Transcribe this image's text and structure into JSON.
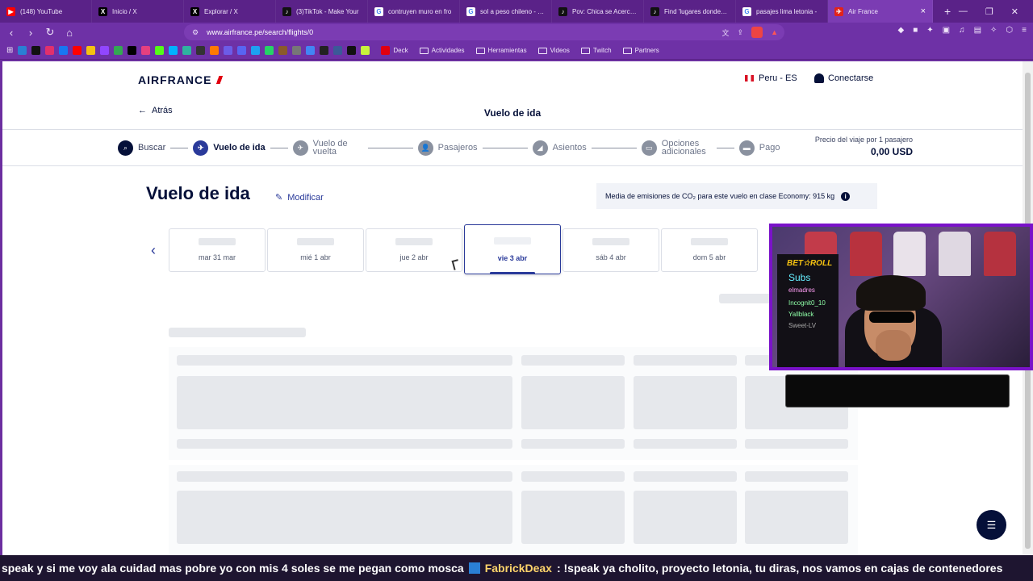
{
  "browser": {
    "tabs": [
      {
        "label": "(148) YouTube",
        "icon": "youtube-icon",
        "color": "#ff0000",
        "glyph": "▶"
      },
      {
        "label": "Inicio / X",
        "icon": "x-icon",
        "color": "#000000",
        "glyph": "X"
      },
      {
        "label": "Explorar / X",
        "icon": "x-icon",
        "color": "#000000",
        "glyph": "X"
      },
      {
        "label": "(3)TikTok - Make Your",
        "icon": "tiktok-icon",
        "color": "#111111",
        "glyph": "♪"
      },
      {
        "label": "contruyen muro en fro",
        "icon": "google-icon",
        "color": "#ffffff",
        "glyph": "G"
      },
      {
        "label": "sol a peso chileno - Go",
        "icon": "google-icon",
        "color": "#ffffff",
        "glyph": "G"
      },
      {
        "label": "Pov: Chica se Acerca a",
        "icon": "tiktok-icon",
        "color": "#111111",
        "glyph": "♪"
      },
      {
        "label": "Find 'lugares donde ha",
        "icon": "tiktok-icon",
        "color": "#111111",
        "glyph": "♪"
      },
      {
        "label": "pasajes lima letonia -",
        "icon": "google-icon",
        "color": "#ffffff",
        "glyph": "G"
      }
    ],
    "active_tab": {
      "label": "Air France",
      "icon": "airfrance-icon"
    },
    "url": "www.airfrance.pe/search/flights/0",
    "bookmarks": [
      "Deck",
      "Actividades",
      "Herramientas",
      "Videos",
      "Twitch",
      "Partners"
    ]
  },
  "header": {
    "logo": "AIRFRANCE",
    "locale": "Peru - ES",
    "login": "Conectarse",
    "back": "Atrás",
    "page_heading": "Vuelo de ida"
  },
  "steps": [
    {
      "label": "Buscar",
      "state": "done",
      "glyph": "⌕"
    },
    {
      "label": "Vuelo de ida",
      "state": "current",
      "glyph": "✈"
    },
    {
      "label": "Vuelo de vuelta",
      "state": "todo",
      "glyph": "✈"
    },
    {
      "label": "Pasajeros",
      "state": "todo",
      "glyph": "👤"
    },
    {
      "label": "Asientos",
      "state": "todo",
      "glyph": "◢"
    },
    {
      "label": "Opciones adicionales",
      "state": "todo",
      "glyph": "▭"
    },
    {
      "label": "Pago",
      "state": "todo",
      "glyph": "▬"
    }
  ],
  "price": {
    "label": "Precio del viaje por 1 pasajero",
    "value": "0,00 USD"
  },
  "main": {
    "title": "Vuelo de ida",
    "modify": "Modificar",
    "co2": "Media de emisiones de CO₂ para este vuelo en clase Economy: 915 kg"
  },
  "dates": [
    {
      "label": "mar 31 mar",
      "selected": false
    },
    {
      "label": "mié 1 abr",
      "selected": false
    },
    {
      "label": "jue 2 abr",
      "selected": false
    },
    {
      "label": "vie 3 abr",
      "selected": true
    },
    {
      "label": "sáb 4 abr",
      "selected": false
    },
    {
      "label": "dom 5 abr",
      "selected": false
    }
  ],
  "stream": {
    "board_title": "BET☆ROLL",
    "board_lines": [
      "Subs",
      "elmadres",
      "Incognit0_10",
      "Yallblack",
      "Sweet-LV"
    ],
    "ticker_start": "speak y si me voy ala cuidad mas pobre yo con mis 4 soles se me pegan como mosca",
    "ticker_user": "FabrickDeax",
    "ticker_msg": ": !speak ya cholito, proyecto letonia, tu diras, nos vamos en cajas de contenedores"
  }
}
